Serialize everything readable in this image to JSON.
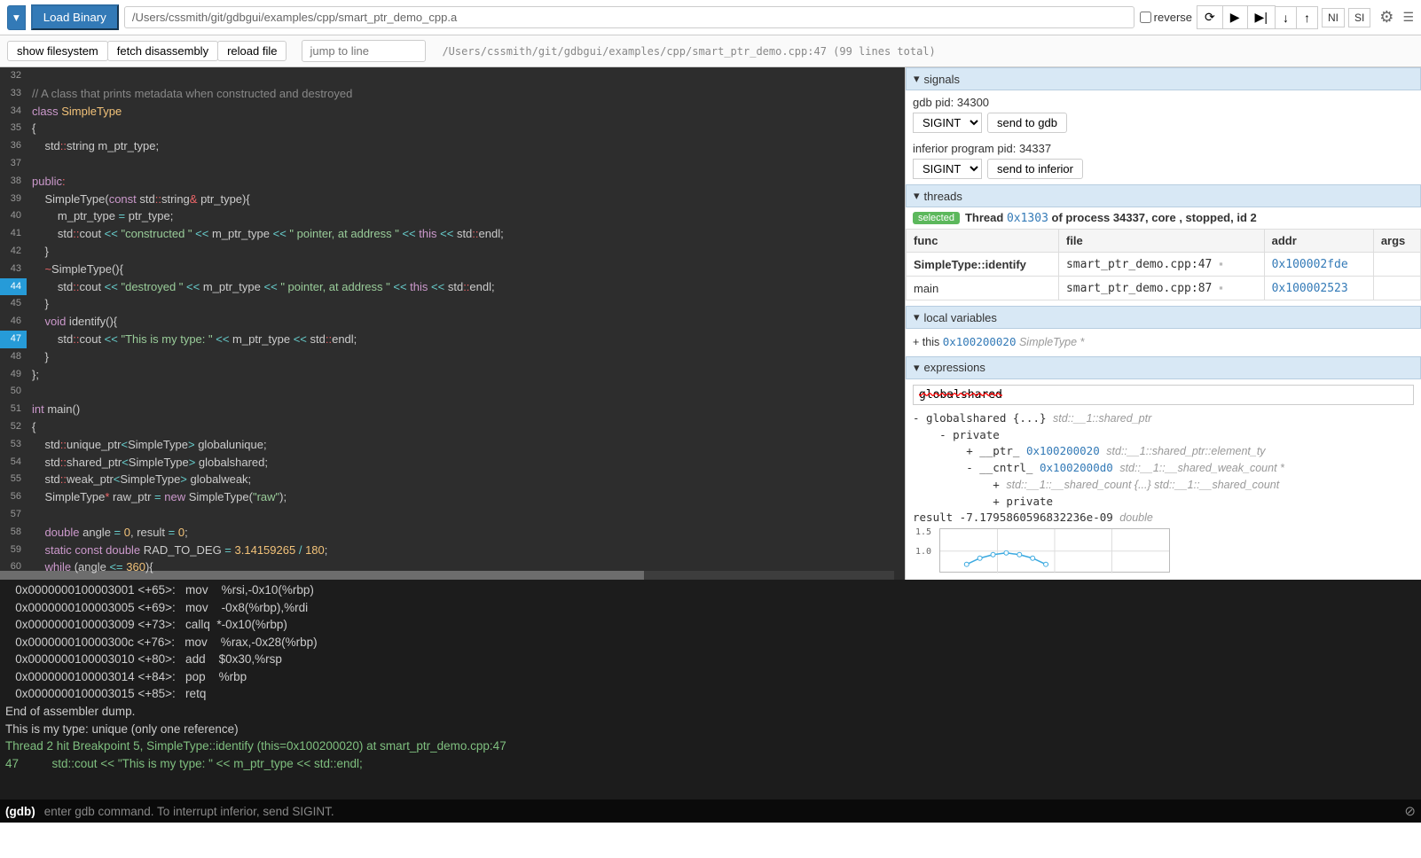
{
  "topbar": {
    "load_binary": "Load Binary",
    "binary_path": "/Users/cssmith/git/gdbgui/examples/cpp/smart_ptr_demo_cpp.a",
    "reverse": "reverse",
    "ni": "NI",
    "si": "SI"
  },
  "subbar": {
    "show_fs": "show filesystem",
    "fetch_dis": "fetch disassembly",
    "reload": "reload file",
    "jump_placeholder": "jump to line",
    "file_meta": "/Users/cssmith/git/gdbgui/examples/cpp/smart_ptr_demo.cpp:47  (99 lines total)"
  },
  "code": {
    "start_line": 32,
    "highlight": [
      44,
      47
    ],
    "lines": [
      {
        "n": 32,
        "t": ""
      },
      {
        "n": 33,
        "t": "// A class that prints metadata when constructed and destroyed",
        "cls": "c-comment"
      },
      {
        "n": 34,
        "html": "<span class='c-kw'>class</span> <span class='c-type'>SimpleType</span>"
      },
      {
        "n": 35,
        "t": "{"
      },
      {
        "n": 36,
        "html": "    std<span class='c-punc'>::</span>string m_ptr_type;"
      },
      {
        "n": 37,
        "t": ""
      },
      {
        "n": 38,
        "html": "<span class='c-kw'>public</span><span class='c-punc'>:</span>"
      },
      {
        "n": 39,
        "html": "    SimpleType(<span class='c-kw'>const</span> std<span class='c-punc'>::</span>string<span class='c-punc'>&amp;</span> ptr_type){"
      },
      {
        "n": 40,
        "html": "        m_ptr_type <span class='c-op'>=</span> ptr_type;"
      },
      {
        "n": 41,
        "html": "        std<span class='c-punc'>::</span>cout <span class='c-op'>&lt;&lt;</span> <span class='c-str'>\"constructed \"</span> <span class='c-op'>&lt;&lt;</span> m_ptr_type <span class='c-op'>&lt;&lt;</span> <span class='c-str'>\" pointer, at address \"</span> <span class='c-op'>&lt;&lt;</span> <span class='c-kw'>this</span> <span class='c-op'>&lt;&lt;</span> std<span class='c-punc'>::</span>endl;"
      },
      {
        "n": 42,
        "t": "    }"
      },
      {
        "n": 43,
        "html": "    <span class='c-punc'>~</span>SimpleType(){"
      },
      {
        "n": 44,
        "html": "        std<span class='c-punc'>::</span>cout <span class='c-op'>&lt;&lt;</span> <span class='c-str'>\"destroyed \"</span> <span class='c-op'>&lt;&lt;</span> m_ptr_type <span class='c-op'>&lt;&lt;</span> <span class='c-str'>\" pointer, at address \"</span> <span class='c-op'>&lt;&lt;</span> <span class='c-kw'>this</span> <span class='c-op'>&lt;&lt;</span> std<span class='c-punc'>::</span>endl;"
      },
      {
        "n": 45,
        "t": "    }"
      },
      {
        "n": 46,
        "html": "    <span class='c-kw'>void</span> identify(){"
      },
      {
        "n": 47,
        "html": "        std<span class='c-punc'>::</span>cout <span class='c-op'>&lt;&lt;</span> <span class='c-str'>\"This is my type: \"</span> <span class='c-op'>&lt;&lt;</span> m_ptr_type <span class='c-op'>&lt;&lt;</span> std<span class='c-punc'>::</span>endl;"
      },
      {
        "n": 48,
        "t": "    }"
      },
      {
        "n": 49,
        "t": "};"
      },
      {
        "n": 50,
        "t": ""
      },
      {
        "n": 51,
        "html": "<span class='c-kw'>int</span> main()"
      },
      {
        "n": 52,
        "t": "{"
      },
      {
        "n": 53,
        "html": "    std<span class='c-punc'>::</span>unique_ptr<span class='c-op'>&lt;</span>SimpleType<span class='c-op'>&gt;</span> globalunique;"
      },
      {
        "n": 54,
        "html": "    std<span class='c-punc'>::</span>shared_ptr<span class='c-op'>&lt;</span>SimpleType<span class='c-op'>&gt;</span> globalshared;"
      },
      {
        "n": 55,
        "html": "    std<span class='c-punc'>::</span>weak_ptr<span class='c-op'>&lt;</span>SimpleType<span class='c-op'>&gt;</span> globalweak;"
      },
      {
        "n": 56,
        "html": "    SimpleType<span class='c-punc'>*</span> raw_ptr <span class='c-op'>=</span> <span class='c-kw'>new</span> SimpleType(<span class='c-str'>\"raw\"</span>);"
      },
      {
        "n": 57,
        "t": ""
      },
      {
        "n": 58,
        "html": "    <span class='c-kw'>double</span> angle <span class='c-op'>=</span> <span class='c-num'>0</span>, result <span class='c-op'>=</span> <span class='c-num'>0</span>;"
      },
      {
        "n": 59,
        "html": "    <span class='c-kw'>static</span> <span class='c-kw'>const</span> <span class='c-kw'>double</span> RAD_TO_DEG <span class='c-op'>=</span> <span class='c-num'>3.14159265</span> <span class='c-op'>/</span> <span class='c-num'>180</span>;"
      },
      {
        "n": 60,
        "html": "    <span class='c-kw'>while</span> (angle <span class='c-op'>&lt;=</span> <span class='c-num'>360</span>){"
      }
    ]
  },
  "signals": {
    "hdr": "signals",
    "gdb_pid_label": "gdb pid: 34300",
    "sig1": "SIGINT",
    "send_gdb": "send to gdb",
    "inf_pid_label": "inferior program pid: 34337",
    "sig2": "SIGINT",
    "send_inf": "send to inferior"
  },
  "threads": {
    "hdr": "threads",
    "selected": "selected",
    "line_pre": "Thread ",
    "addr": "0x1303",
    "line_post": " of process 34337, core , stopped, id 2",
    "cols": {
      "func": "func",
      "file": "file",
      "addr": "addr",
      "args": "args"
    },
    "rows": [
      {
        "func": "SimpleType::identify",
        "file": "smart_ptr_demo.cpp:47",
        "addr": "0x100002fde",
        "args": ""
      },
      {
        "func": "main",
        "file": "smart_ptr_demo.cpp:87",
        "addr": "0x100002523",
        "args": ""
      }
    ]
  },
  "locals": {
    "hdr": "local variables",
    "row": "+ this 0x100200020 SimpleType *",
    "row_parts": {
      "bullet": "+ this ",
      "addr": "0x100200020",
      "type": " SimpleType *"
    }
  },
  "expr": {
    "hdr": "expressions",
    "input": "globalshared",
    "tree": [
      "- globalshared {...} std::__1::shared_ptr<SimpleType>",
      "    - private",
      "        + __ptr_ 0x100200020 std::__1::shared_ptr<SimpleType>::element_ty",
      "        - __cntrl_ 0x1002000d0 std::__1::__shared_weak_count *",
      "            + std::__1::__shared_count {...} std::__1::__shared_count",
      "            + private",
      "result -7.1795860596832236e-09 double"
    ],
    "yticks": [
      "1.5",
      "1.0"
    ]
  },
  "console_lines": [
    "   0x0000000100003001 <+65>:   mov    %rsi,-0x10(%rbp)",
    "   0x0000000100003005 <+69>:   mov    -0x8(%rbp),%rdi",
    "   0x0000000100003009 <+73>:   callq  *-0x10(%rbp)",
    "   0x000000010000300c <+76>:   mov    %rax,-0x28(%rbp)",
    "   0x0000000100003010 <+80>:   add    $0x30,%rsp",
    "   0x0000000100003014 <+84>:   pop    %rbp",
    "   0x0000000100003015 <+85>:   retq   ",
    "End of assembler dump.",
    "This is my type: unique (only one reference)",
    "",
    "Thread 2 hit Breakpoint 5, SimpleType::identify (this=0x100200020) at smart_ptr_demo.cpp:47",
    "47          std::cout << \"This is my type: \" << m_ptr_type << std::endl;"
  ],
  "gdb": {
    "prompt": "(gdb)",
    "hint": "enter gdb command. To interrupt inferior, send SIGINT."
  }
}
